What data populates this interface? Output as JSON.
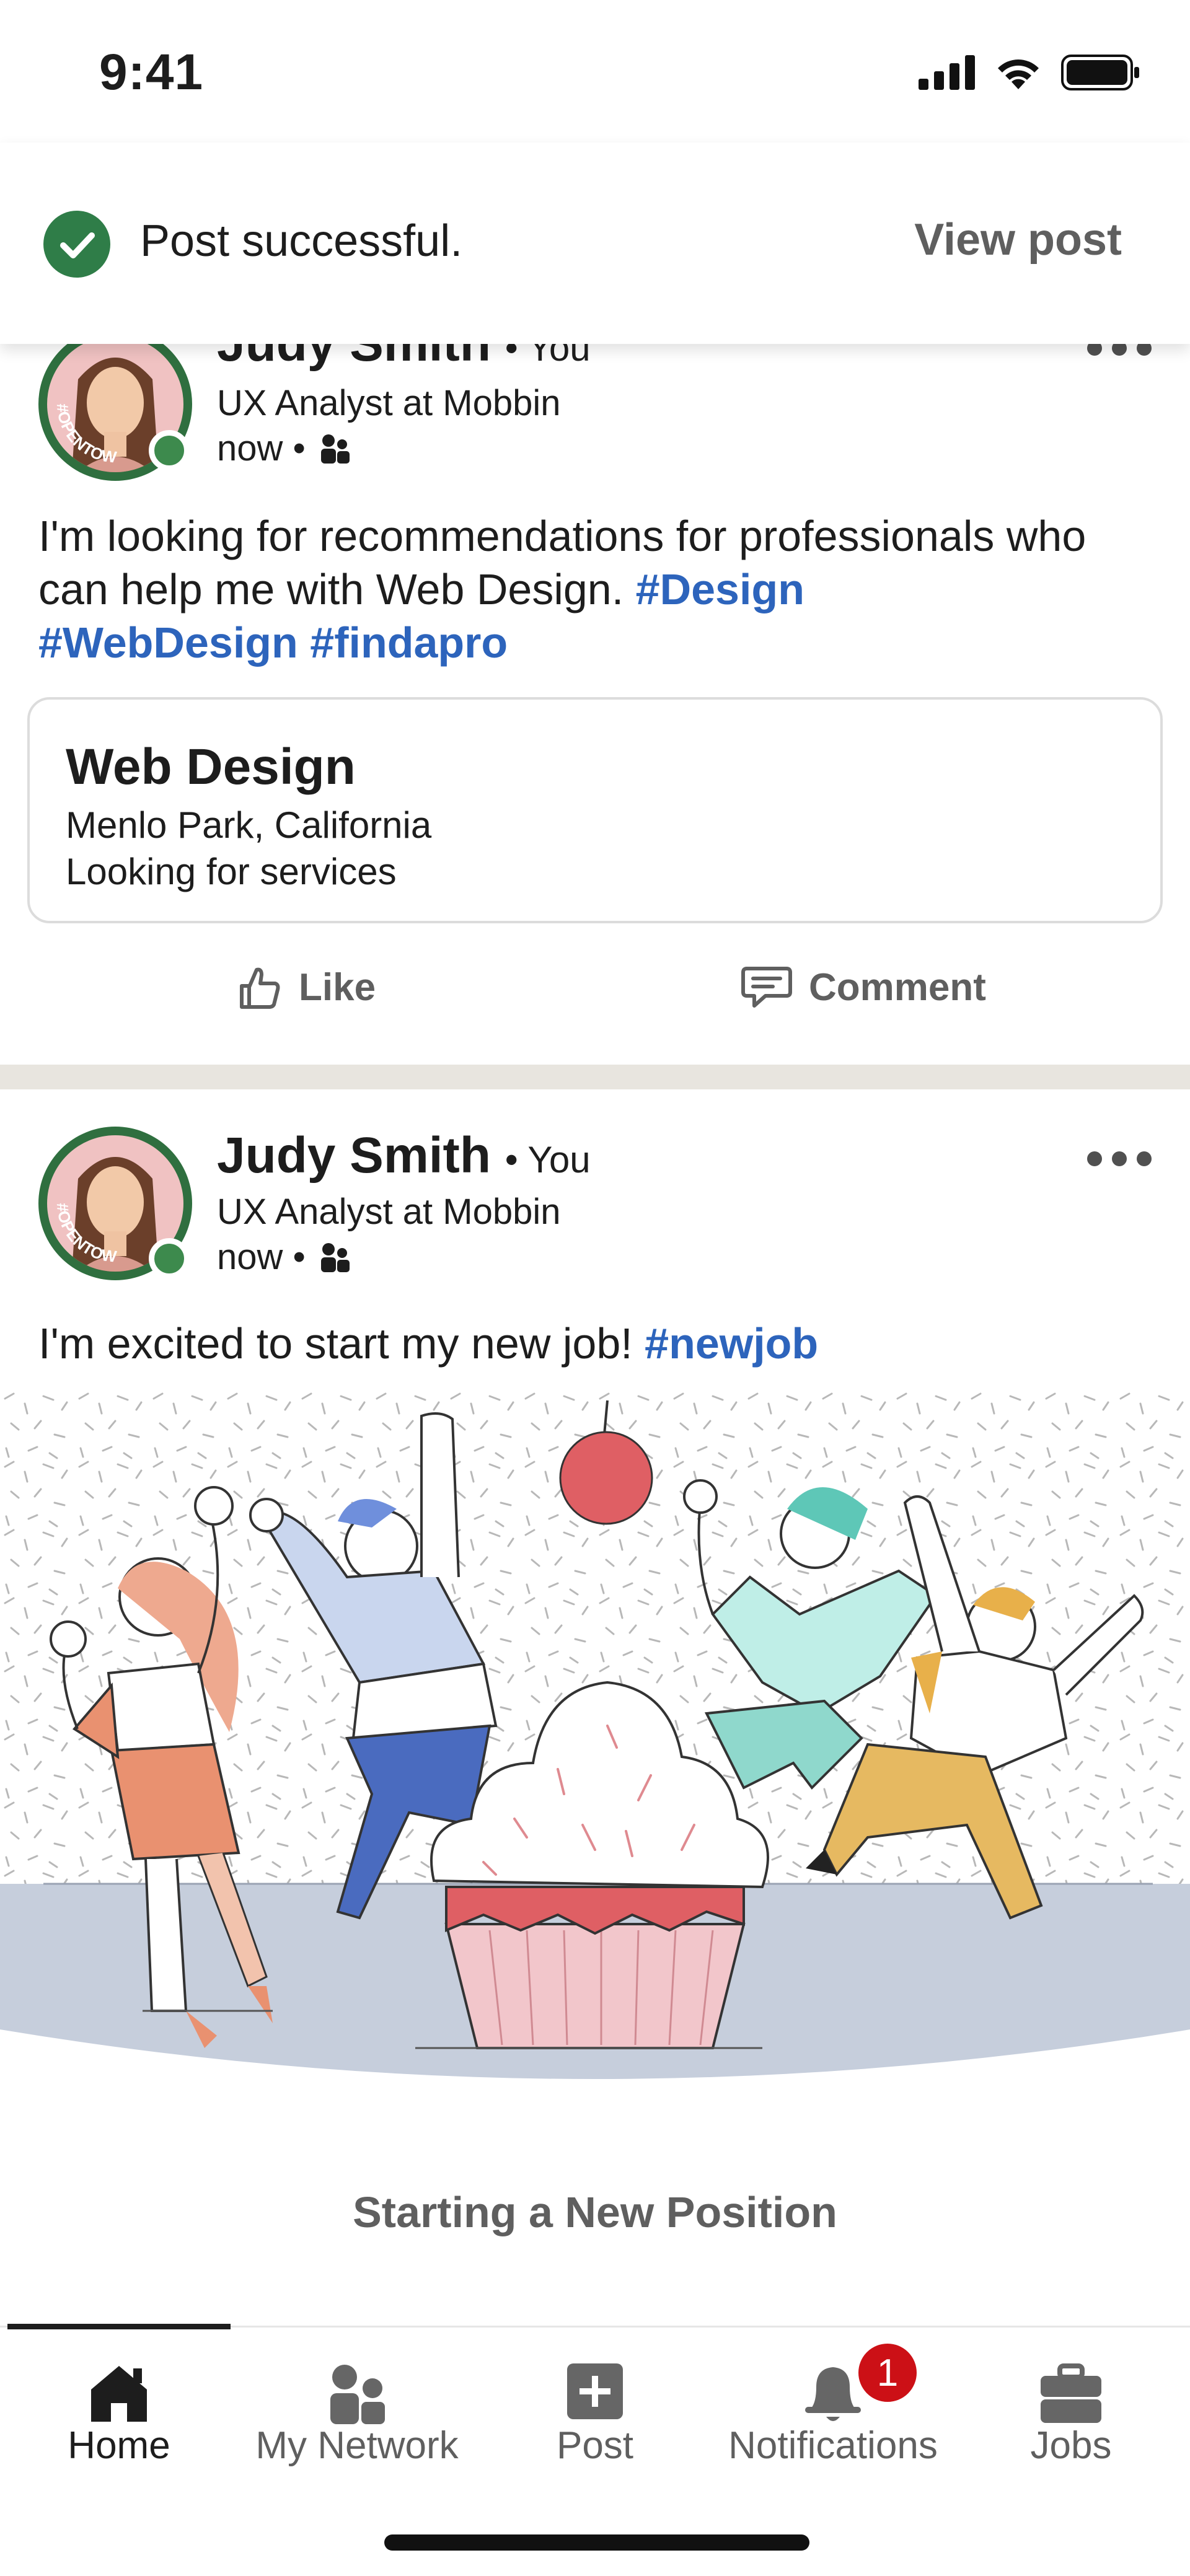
{
  "status_bar": {
    "time": "9:41"
  },
  "toast": {
    "message": "Post successful.",
    "action": "View post"
  },
  "posts": [
    {
      "author": "Judy Smith",
      "relation": "• You",
      "headline": "UX Analyst at Mobbin",
      "time": "now •",
      "avatar_badge": "#OPENTOWORK",
      "text_before": "I'm looking for recommendations for professionals who can help me with Web Design. ",
      "hashtags": [
        "#Design",
        "#WebDesign",
        "#findapro"
      ],
      "service": {
        "title": "Web Design",
        "location": "Menlo Park, California",
        "status": "Looking for services"
      },
      "actions": {
        "like": "Like",
        "comment": "Comment"
      }
    },
    {
      "author": "Judy Smith",
      "relation": "• You",
      "headline": "UX Analyst at Mobbin",
      "time": "now •",
      "avatar_badge": "#OPENTOWORK",
      "text_before": "I'm excited to start my new job! ",
      "hashtags": [
        "#newjob"
      ],
      "caption": "Starting a New Position"
    }
  ],
  "nav": {
    "items": [
      {
        "label": "Home",
        "icon": "home-icon",
        "active": true
      },
      {
        "label": "My Network",
        "icon": "network-icon"
      },
      {
        "label": "Post",
        "icon": "post-icon"
      },
      {
        "label": "Notifications",
        "icon": "bell-icon",
        "badge": "1"
      },
      {
        "label": "Jobs",
        "icon": "briefcase-icon"
      }
    ]
  },
  "colors": {
    "hashtag": "#2d64bc",
    "success": "#2f7d48",
    "badge": "#cc1016",
    "muted": "#5f5f5f"
  }
}
